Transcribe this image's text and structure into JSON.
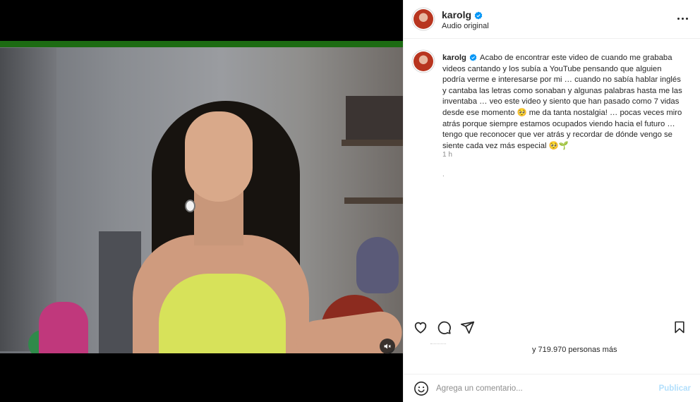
{
  "post": {
    "username": "karolg",
    "verified": true,
    "audio_label": "Audio original",
    "caption": "Acabo de encontrar este video de cuando me grababa videos cantando y los subía a YouTube pensando que alguien podría verme e interesarse por mi … cuando no sabía hablar inglés y cantaba las letras como sonaban y algunas palabras hasta me las inventaba … veo este video y siento que han pasado como 7 vidas desde ese momento 🥺 me da tanta nostalgia! … pocas veces miro atrás porque siempre estamos ocupados viendo hacia el futuro … tengo que reconocer que ver atrás y recordar de dónde vengo se siente cada vez más especial 🥺🌱",
    "time_ago": "1 h",
    "dot": ".",
    "likes_text": "y 719.970 personas más"
  },
  "comment_box": {
    "placeholder": "Agrega un comentario...",
    "publish_label": "Publicar"
  },
  "icons": {
    "more": "more-options-icon",
    "like": "heart-icon",
    "comment": "comment-bubble-icon",
    "share": "paper-plane-icon",
    "save": "bookmark-icon",
    "emoji": "emoji-smile-icon",
    "mute": "speaker-muted-icon",
    "verified": "verified-badge-icon"
  },
  "colors": {
    "verified_blue": "#0095f6",
    "publish_disabled": "#b2dffc",
    "video_green_bar": "#1c6b12"
  }
}
